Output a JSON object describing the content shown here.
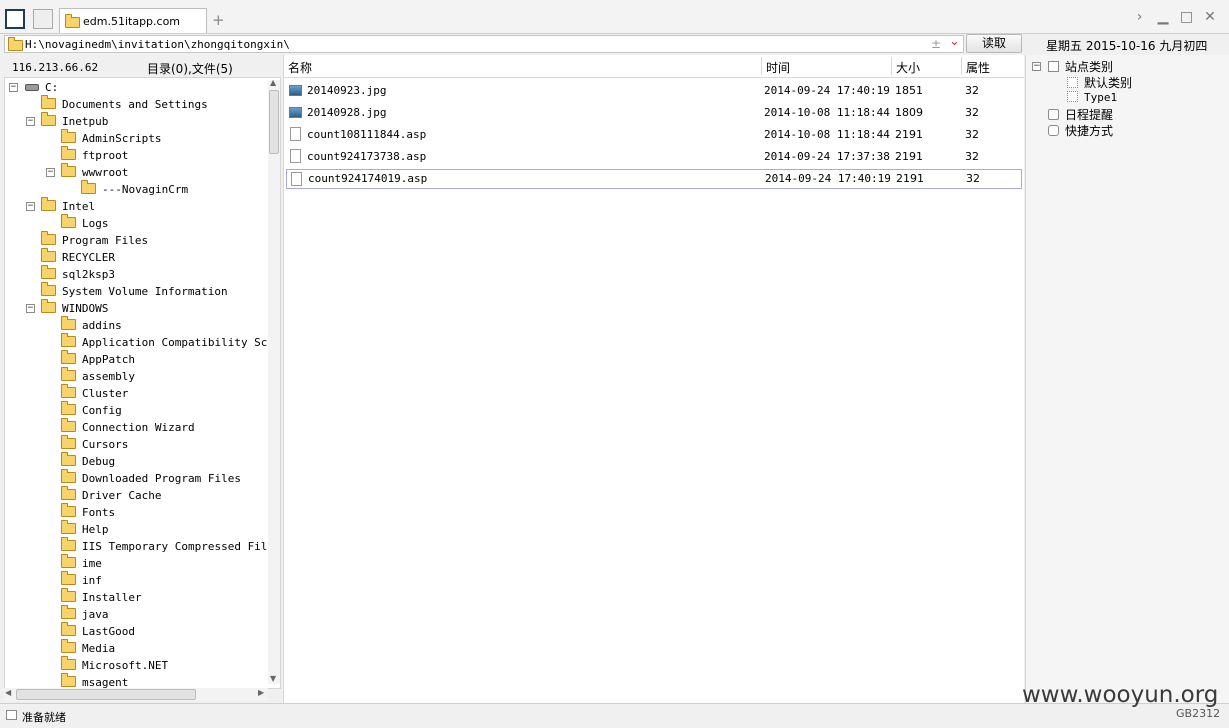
{
  "tab": {
    "title": "edm.51itapp.com",
    "new_tab": "+"
  },
  "window_controls": {
    "forward": "›",
    "minimize": "▁",
    "maximize": "□",
    "close": "✕"
  },
  "address": {
    "path": "H:\\novaginedm\\invitation\\zhongqitongxin\\",
    "plusminus": "±",
    "dropdown": "⌄",
    "read_label": "读取"
  },
  "date": "星期五  2015-10-16  九月初四",
  "left_panel": {
    "ip": "116.213.66.62",
    "count": "目录(0),文件(5)",
    "tree": [
      {
        "label": "C:",
        "level": 0,
        "exp": "−",
        "icon": "drive"
      },
      {
        "label": "Documents and Settings",
        "level": 1
      },
      {
        "label": "Inetpub",
        "level": 1,
        "exp": "−"
      },
      {
        "label": "AdminScripts",
        "level": 2
      },
      {
        "label": "ftproot",
        "level": 2
      },
      {
        "label": "wwwroot",
        "level": 2,
        "exp": "−"
      },
      {
        "label": "---NovaginCrm",
        "level": 3
      },
      {
        "label": "Intel",
        "level": 1,
        "exp": "−"
      },
      {
        "label": "Logs",
        "level": 2
      },
      {
        "label": "Program Files",
        "level": 1
      },
      {
        "label": "RECYCLER",
        "level": 1
      },
      {
        "label": "sql2ksp3",
        "level": 1
      },
      {
        "label": "System Volume Information",
        "level": 1
      },
      {
        "label": "WINDOWS",
        "level": 1,
        "exp": "−"
      },
      {
        "label": "addins",
        "level": 2
      },
      {
        "label": "Application Compatibility Scrip",
        "level": 2
      },
      {
        "label": "AppPatch",
        "level": 2
      },
      {
        "label": "assembly",
        "level": 2
      },
      {
        "label": "Cluster",
        "level": 2
      },
      {
        "label": "Config",
        "level": 2
      },
      {
        "label": "Connection Wizard",
        "level": 2
      },
      {
        "label": "Cursors",
        "level": 2
      },
      {
        "label": "Debug",
        "level": 2
      },
      {
        "label": "Downloaded Program Files",
        "level": 2
      },
      {
        "label": "Driver Cache",
        "level": 2
      },
      {
        "label": "Fonts",
        "level": 2
      },
      {
        "label": "Help",
        "level": 2
      },
      {
        "label": "IIS Temporary Compressed Files",
        "level": 2
      },
      {
        "label": "ime",
        "level": 2
      },
      {
        "label": "inf",
        "level": 2
      },
      {
        "label": "Installer",
        "level": 2
      },
      {
        "label": "java",
        "level": 2
      },
      {
        "label": "LastGood",
        "level": 2
      },
      {
        "label": "Media",
        "level": 2
      },
      {
        "label": "Microsoft.NET",
        "level": 2
      },
      {
        "label": "msagent",
        "level": 2
      }
    ]
  },
  "file_list": {
    "columns": {
      "name": "名称",
      "time": "时间",
      "size": "大小",
      "attr": "属性"
    },
    "rows": [
      {
        "name": "20140923.jpg",
        "time": "2014-09-24 17:40:19",
        "size": "1851",
        "attr": "32",
        "icon": "image"
      },
      {
        "name": "20140928.jpg",
        "time": "2014-10-08 11:18:44",
        "size": "1809",
        "attr": "32",
        "icon": "image"
      },
      {
        "name": "count108111844.asp",
        "time": "2014-10-08 11:18:44",
        "size": "2191",
        "attr": "32",
        "icon": "doc"
      },
      {
        "name": "count924173738.asp",
        "time": "2014-09-24 17:37:38",
        "size": "2191",
        "attr": "32",
        "icon": "doc"
      },
      {
        "name": "count924174019.asp",
        "time": "2014-09-24 17:40:19",
        "size": "2191",
        "attr": "32",
        "icon": "doc",
        "selected": true
      }
    ]
  },
  "right_panel": {
    "site_category": "站点类别",
    "default_category": "默认类别",
    "type1": "Type1",
    "schedule": "日程提醒",
    "shortcuts": "快捷方式"
  },
  "status": {
    "text": "准备就绪",
    "encoding": "GB2312",
    "watermark": "www.wooyun.org"
  }
}
